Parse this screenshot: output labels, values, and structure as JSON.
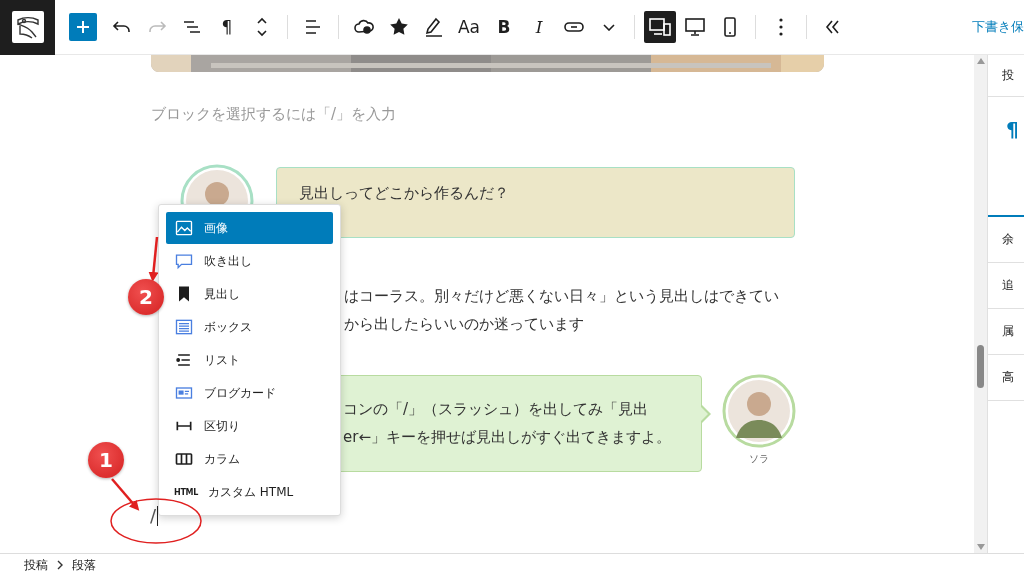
{
  "toolbar": {
    "buttons": [
      {
        "kind": "add"
      },
      {
        "kind": "undo",
        "disabled": false
      },
      {
        "kind": "redo",
        "disabled": true
      },
      {
        "kind": "list-view"
      },
      {
        "kind": "paragraph",
        "label": "¶"
      },
      {
        "kind": "move"
      },
      {
        "kind": "separator"
      },
      {
        "kind": "align"
      },
      {
        "kind": "separator"
      },
      {
        "kind": "cloud"
      },
      {
        "kind": "star"
      },
      {
        "kind": "highlight"
      },
      {
        "kind": "font",
        "label": "Aa"
      },
      {
        "kind": "bold",
        "label": "B"
      },
      {
        "kind": "italic",
        "label": "I"
      },
      {
        "kind": "link"
      },
      {
        "kind": "more-format"
      },
      {
        "kind": "separator"
      },
      {
        "kind": "responsive",
        "selected": true
      },
      {
        "kind": "desktop",
        "selected": false
      },
      {
        "kind": "mobile",
        "selected": false
      },
      {
        "kind": "separator"
      },
      {
        "kind": "options"
      },
      {
        "kind": "separator"
      },
      {
        "kind": "collapse"
      }
    ],
    "save_label": "下書き保"
  },
  "canvas": {
    "placeholder": "ブロックを選択するには「/」を入力",
    "blocks": [
      {
        "kind": "balloon-left",
        "color": "#ece7c8",
        "lines": [
          "見出しってどこから作るんだ？"
        ]
      },
      {
        "kind": "paragraph",
        "lines": [
          "はコーラス。別々だけど悪くない日々」という見出しはできてい",
          "から出したらいいのか迷っています"
        ]
      },
      {
        "kind": "balloon-right",
        "color": "#dff2d3",
        "lines": [
          "コンの「/」（スラッシュ）を出してみ「見出",
          "er←」キーを押せば見出しがすぐ出てきますよ。"
        ],
        "avatar_name": "ソラ"
      },
      {
        "kind": "typed",
        "text": "/"
      }
    ]
  },
  "block_menu": {
    "items": [
      {
        "label": "画像",
        "selected": true
      },
      {
        "label": "吹き出し",
        "selected": false
      },
      {
        "label": "見出し",
        "selected": false
      },
      {
        "label": "ボックス",
        "selected": false
      },
      {
        "label": "リスト",
        "selected": false
      },
      {
        "label": "ブログカード",
        "selected": false
      },
      {
        "label": "区切り",
        "selected": false
      },
      {
        "label": "カラム",
        "selected": false
      },
      {
        "label": "カスタム HTML",
        "selected": false,
        "icon_label": "HTML"
      }
    ]
  },
  "annotations": [
    {
      "label": "1"
    },
    {
      "label": "2"
    }
  ],
  "sidebar": {
    "tab": "投",
    "block_icon": "¶",
    "panels": [
      "余",
      "追",
      "属",
      "高"
    ]
  },
  "breadcrumb": [
    "投稿",
    "段落"
  ]
}
